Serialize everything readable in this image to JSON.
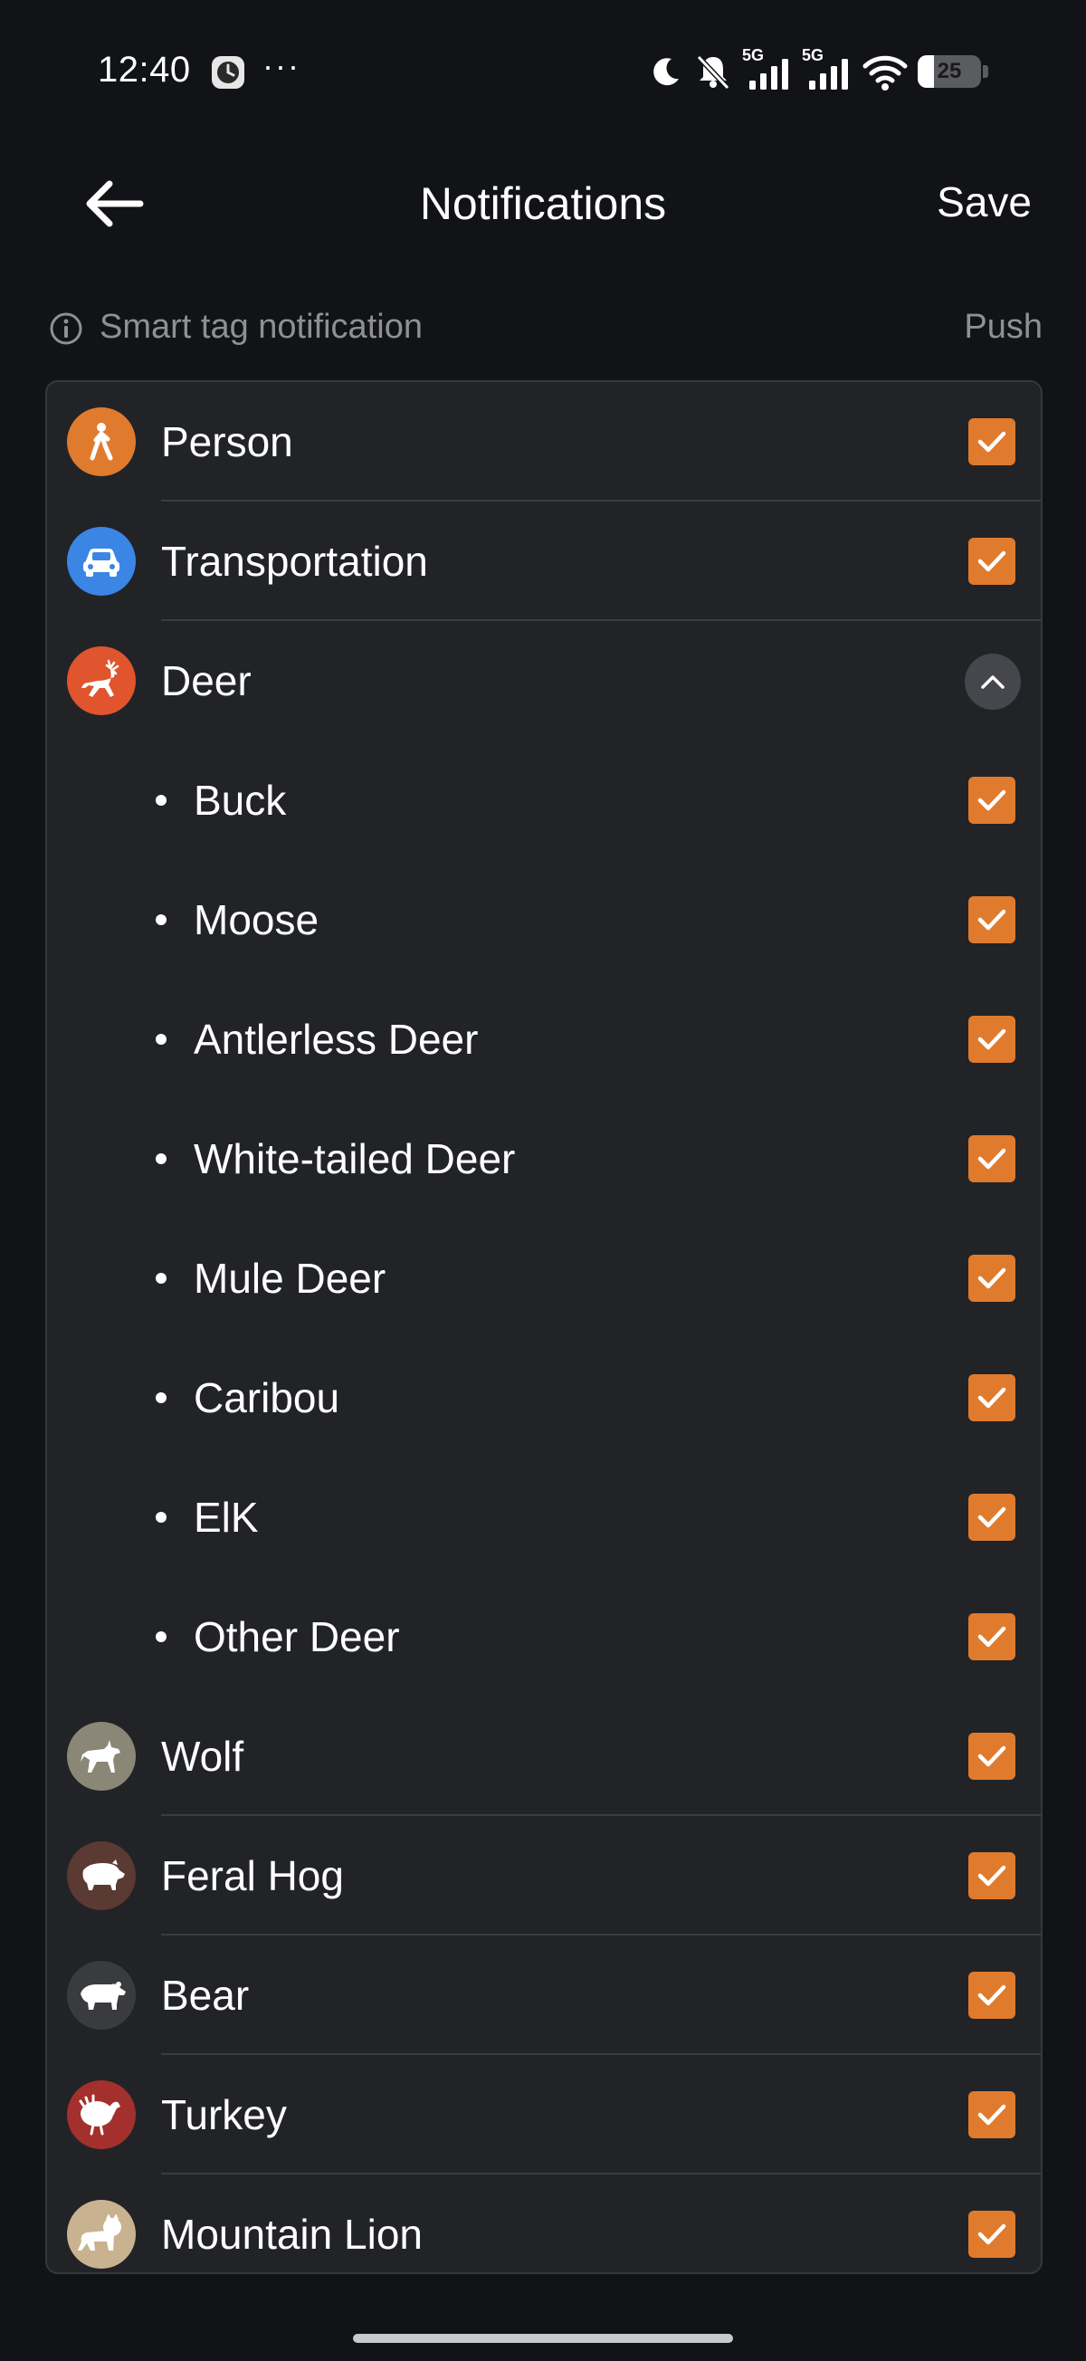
{
  "status_bar": {
    "time": "12:40",
    "dots": "···",
    "network_1": "5G",
    "network_2": "5G",
    "battery_level": "25",
    "battery_fraction": 0.25
  },
  "header": {
    "title": "Notifications",
    "save_label": "Save"
  },
  "section": {
    "label": "Smart tag notification",
    "column_label": "Push"
  },
  "colors": {
    "accent": "#e07b2e",
    "background": "#121316",
    "card": "#222327"
  },
  "categories": [
    {
      "label": "Person",
      "icon": "person-walking-icon",
      "color": "#e07b2e",
      "checked": true
    },
    {
      "label": "Transportation",
      "icon": "car-icon",
      "color": "#3b86e5",
      "checked": true
    },
    {
      "label": "Deer",
      "icon": "deer-icon",
      "color": "#e0542e",
      "expanded": true,
      "subcategories": [
        {
          "label": "Buck",
          "checked": true
        },
        {
          "label": "Moose",
          "checked": true
        },
        {
          "label": "Antlerless Deer",
          "checked": true
        },
        {
          "label": "White-tailed Deer",
          "checked": true
        },
        {
          "label": "Mule Deer",
          "checked": true
        },
        {
          "label": "Caribou",
          "checked": true
        },
        {
          "label": "ElK",
          "checked": true
        },
        {
          "label": "Other Deer",
          "checked": true
        }
      ]
    },
    {
      "label": "Wolf",
      "icon": "wolf-icon",
      "color": "#8b8776",
      "checked": true
    },
    {
      "label": "Feral Hog",
      "icon": "hog-icon",
      "color": "#5a3a33",
      "checked": true
    },
    {
      "label": "Bear",
      "icon": "bear-icon",
      "color": "#3a3b3f",
      "checked": true
    },
    {
      "label": "Turkey",
      "icon": "turkey-icon",
      "color": "#a3302c",
      "checked": true
    },
    {
      "label": "Mountain Lion",
      "icon": "mountain-lion-icon",
      "color": "#c9b28f",
      "checked": true
    }
  ]
}
